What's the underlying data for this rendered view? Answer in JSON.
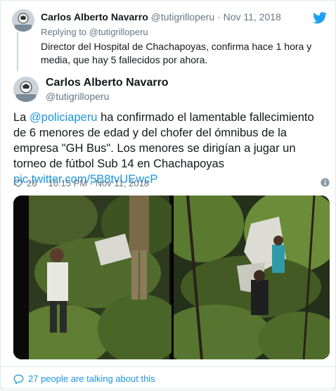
{
  "parent_tweet": {
    "name": "Carlos Alberto Navarro",
    "handle": "@tutigrilloperu",
    "separator": "·",
    "date": "Nov 11, 2018",
    "reply_label": "Replying to @tutigrilloperu",
    "text": "Director del Hospital de Chachapoyas, confirma hace 1 hora y media, que hay 5 fallecidos por ahora."
  },
  "main_tweet": {
    "name": "Carlos Alberto Navarro",
    "handle": "@tutigrilloperu",
    "text_prefix": "La ",
    "mention": "@policiaperu",
    "text_body": " ha confirmado el lamentable fallecimiento de 6 menores de edad y del chofer del ómnibus de la empresa \"GH Bus\". Los menores se dirigían a jugar un torneo de fútbol Sub 14 en Chachapoyas ",
    "pic_link": "pic.twitter.com/5B8tvUEwcP",
    "likes": "26",
    "timestamp": "10:15 PM - Nov 11, 2018"
  },
  "footer": {
    "talking": "27 people are talking about this"
  },
  "icons": {
    "bird": "twitter-bird-icon",
    "heart": "heart-icon",
    "info": "info-icon",
    "bubble": "reply-bubble-icon"
  },
  "colors": {
    "link": "#1b95e0",
    "muted": "#657786",
    "text": "#14171a",
    "border": "#e1e8ed"
  }
}
